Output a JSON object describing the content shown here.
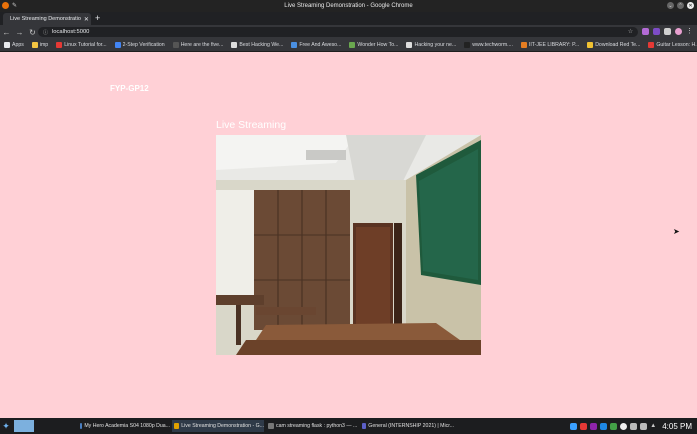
{
  "window": {
    "title": "Live Streaming Demonstration - Google Chrome"
  },
  "browser": {
    "tab": {
      "label": "Live Streaming Demonstratio"
    },
    "new_tab_glyph": "+",
    "url": "localhost:5000",
    "bookmarks": [
      {
        "label": "Apps",
        "color": "#e8eaed"
      },
      {
        "label": "imp",
        "color": "#f4c542"
      },
      {
        "label": "Linux Tutorial for...",
        "color": "#e53935"
      },
      {
        "label": "2-Step Verification",
        "color": "#4285f4"
      },
      {
        "label": "Here are the five...",
        "color": "#555555"
      },
      {
        "label": "Best Hacking We...",
        "color": "#dddddd"
      },
      {
        "label": "Free And Aweso...",
        "color": "#4a90e2"
      },
      {
        "label": "Wonder How To...",
        "color": "#6aa84f"
      },
      {
        "label": "Hacking your ne...",
        "color": "#dddddd"
      },
      {
        "label": "www.techworm....",
        "color": "#222222"
      },
      {
        "label": "IIT-JEE LIBRARY: P...",
        "color": "#e67e22"
      },
      {
        "label": "Download Red Te...",
        "color": "#f1c232"
      },
      {
        "label": "Guitar Lesson: H...",
        "color": "#e53935"
      }
    ]
  },
  "page": {
    "brand": "FYP-GP12",
    "heading": "Live Streaming",
    "background_color": "#ffd0d6"
  },
  "taskbar": {
    "tasks": [
      {
        "label": "My Hero Academia S04 1080p Dua...",
        "icon": "video-file-icon",
        "color": "#4a7fc1"
      },
      {
        "label": "Live Streaming Demonstration - G...",
        "icon": "chrome-icon",
        "color": "#e0a100"
      },
      {
        "label": "cam streaming flask : python3 — ...",
        "icon": "terminal-icon",
        "color": "#777777"
      },
      {
        "label": "General (INTERNSHIP 2021) | Micr...",
        "icon": "teams-icon",
        "color": "#5b5fc7"
      }
    ],
    "clock": "4:05 PM"
  }
}
